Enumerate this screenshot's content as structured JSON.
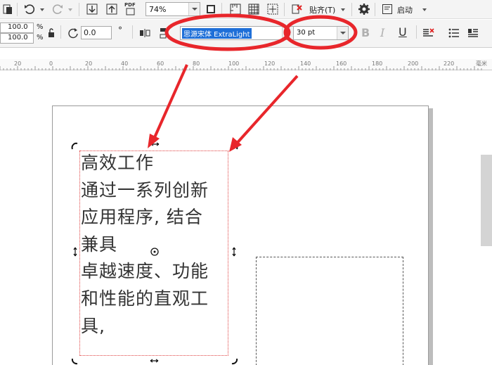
{
  "toolbar": {
    "zoom_value": "74%",
    "pdf_label": "PDF",
    "snap_label": "贴齐(T)",
    "launch_label": "启动"
  },
  "property_bar": {
    "width_value": "100.0",
    "height_value": "100.0",
    "percent_symbol": "%",
    "rotation_value": "0.0",
    "degree_symbol": "°",
    "font_name": "思源宋体 ExtraLight",
    "font_size": "30 pt",
    "bold_label": "B",
    "italic_label": "I",
    "underline_label": "U"
  },
  "ruler": {
    "labels": [
      "20",
      "0",
      "20",
      "40",
      "60",
      "80",
      "100",
      "120",
      "140",
      "160",
      "180",
      "200",
      "220"
    ],
    "unit": "毫米"
  },
  "document": {
    "text_lines": [
      "高效工作",
      "通过一系列创新",
      "应用程序, 结合",
      "兼具",
      "卓越速度、功能",
      "和性能的直观工",
      "具,"
    ]
  },
  "annotation": {
    "highlight_color": "#e8262b"
  }
}
